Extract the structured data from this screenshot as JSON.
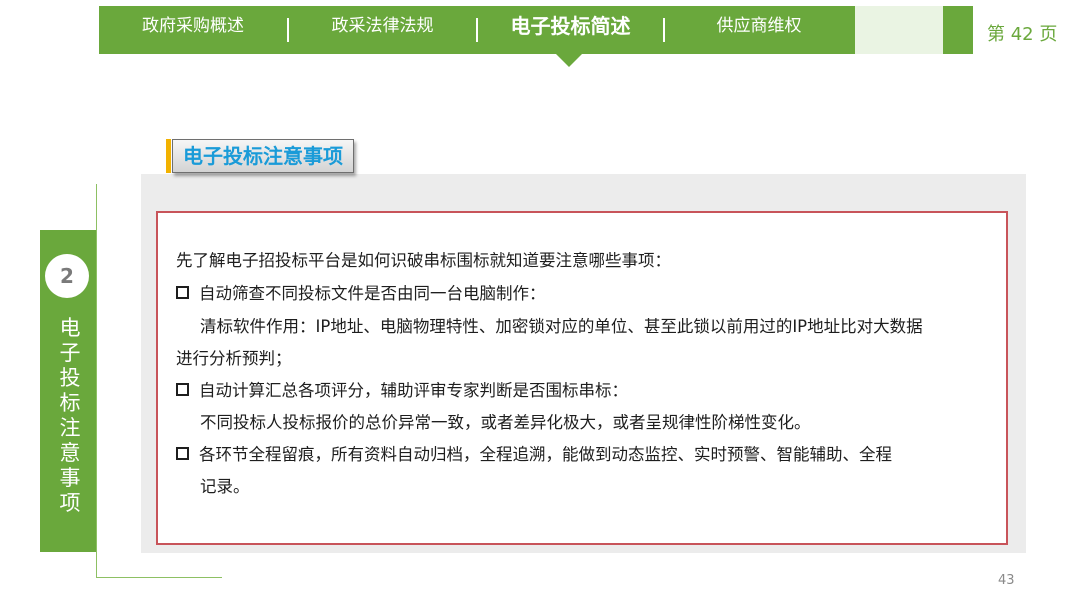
{
  "nav": {
    "tabs": [
      {
        "label": "政府采购概述"
      },
      {
        "label": "政采法律法规"
      },
      {
        "label": "电子投标简述"
      },
      {
        "label": "供应商维权"
      }
    ],
    "page_label": "第 42 页"
  },
  "side": {
    "number": "2",
    "vertical_label": "电子投标注意事项"
  },
  "section": {
    "title": "电子投标注意事项"
  },
  "content": {
    "intro": "先了解电子招投标平台是如何识破串标围标就知道要注意哪些事项：",
    "item1": "自动筛查不同投标文件是否由同一台电脑制作：",
    "item1_detail_line1": "清标软件作用：IP地址、电脑物理特性、加密锁对应的单位、甚至此锁以前用过的IP地址比对大数据",
    "item1_detail_line2": "进行分析预判；",
    "item2": "自动计算汇总各项评分，辅助评审专家判断是否围标串标：",
    "item2_detail": "不同投标人投标报价的总价异常一致，或者差异化极大，或者呈规律性阶梯性变化。",
    "item3_line1": "各环节全程留痕，所有资料自动归档，全程追溯，能做到动态监控、实时预警、智能辅助、全程",
    "item3_line2": "记录。"
  },
  "footer": {
    "slide_number": "43"
  }
}
